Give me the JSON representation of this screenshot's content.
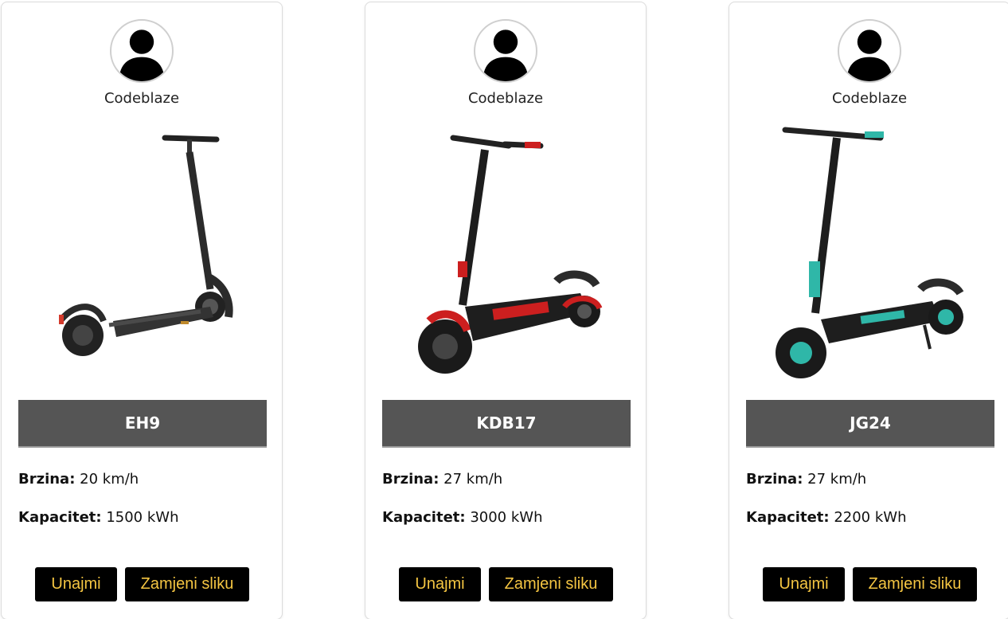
{
  "colors": {
    "name_bar_bg": "#555555",
    "button_bg": "#000000",
    "button_text": "#f4c542"
  },
  "cards": [
    {
      "username": "Codeblaze",
      "model": "EH9",
      "speed_label": "Brzina:",
      "speed_value": "20 km/h",
      "capacity_label": "Kapacitet:",
      "capacity_value": "1500 kWh",
      "rent_label": "Unajmi",
      "change_image_label": "Zamjeni sliku",
      "accent": "#d33a2c"
    },
    {
      "username": "Codeblaze",
      "model": "KDB17",
      "speed_label": "Brzina:",
      "speed_value": "27 km/h",
      "capacity_label": "Kapacitet:",
      "capacity_value": "3000 kWh",
      "rent_label": "Unajmi",
      "change_image_label": "Zamjeni sliku",
      "accent": "#cc1f1f"
    },
    {
      "username": "Codeblaze",
      "model": "JG24",
      "speed_label": "Brzina:",
      "speed_value": "27 km/h",
      "capacity_label": "Kapacitet:",
      "capacity_value": "2200 kWh",
      "rent_label": "Unajmi",
      "change_image_label": "Zamjeni sliku",
      "accent": "#2fb7a8"
    }
  ]
}
